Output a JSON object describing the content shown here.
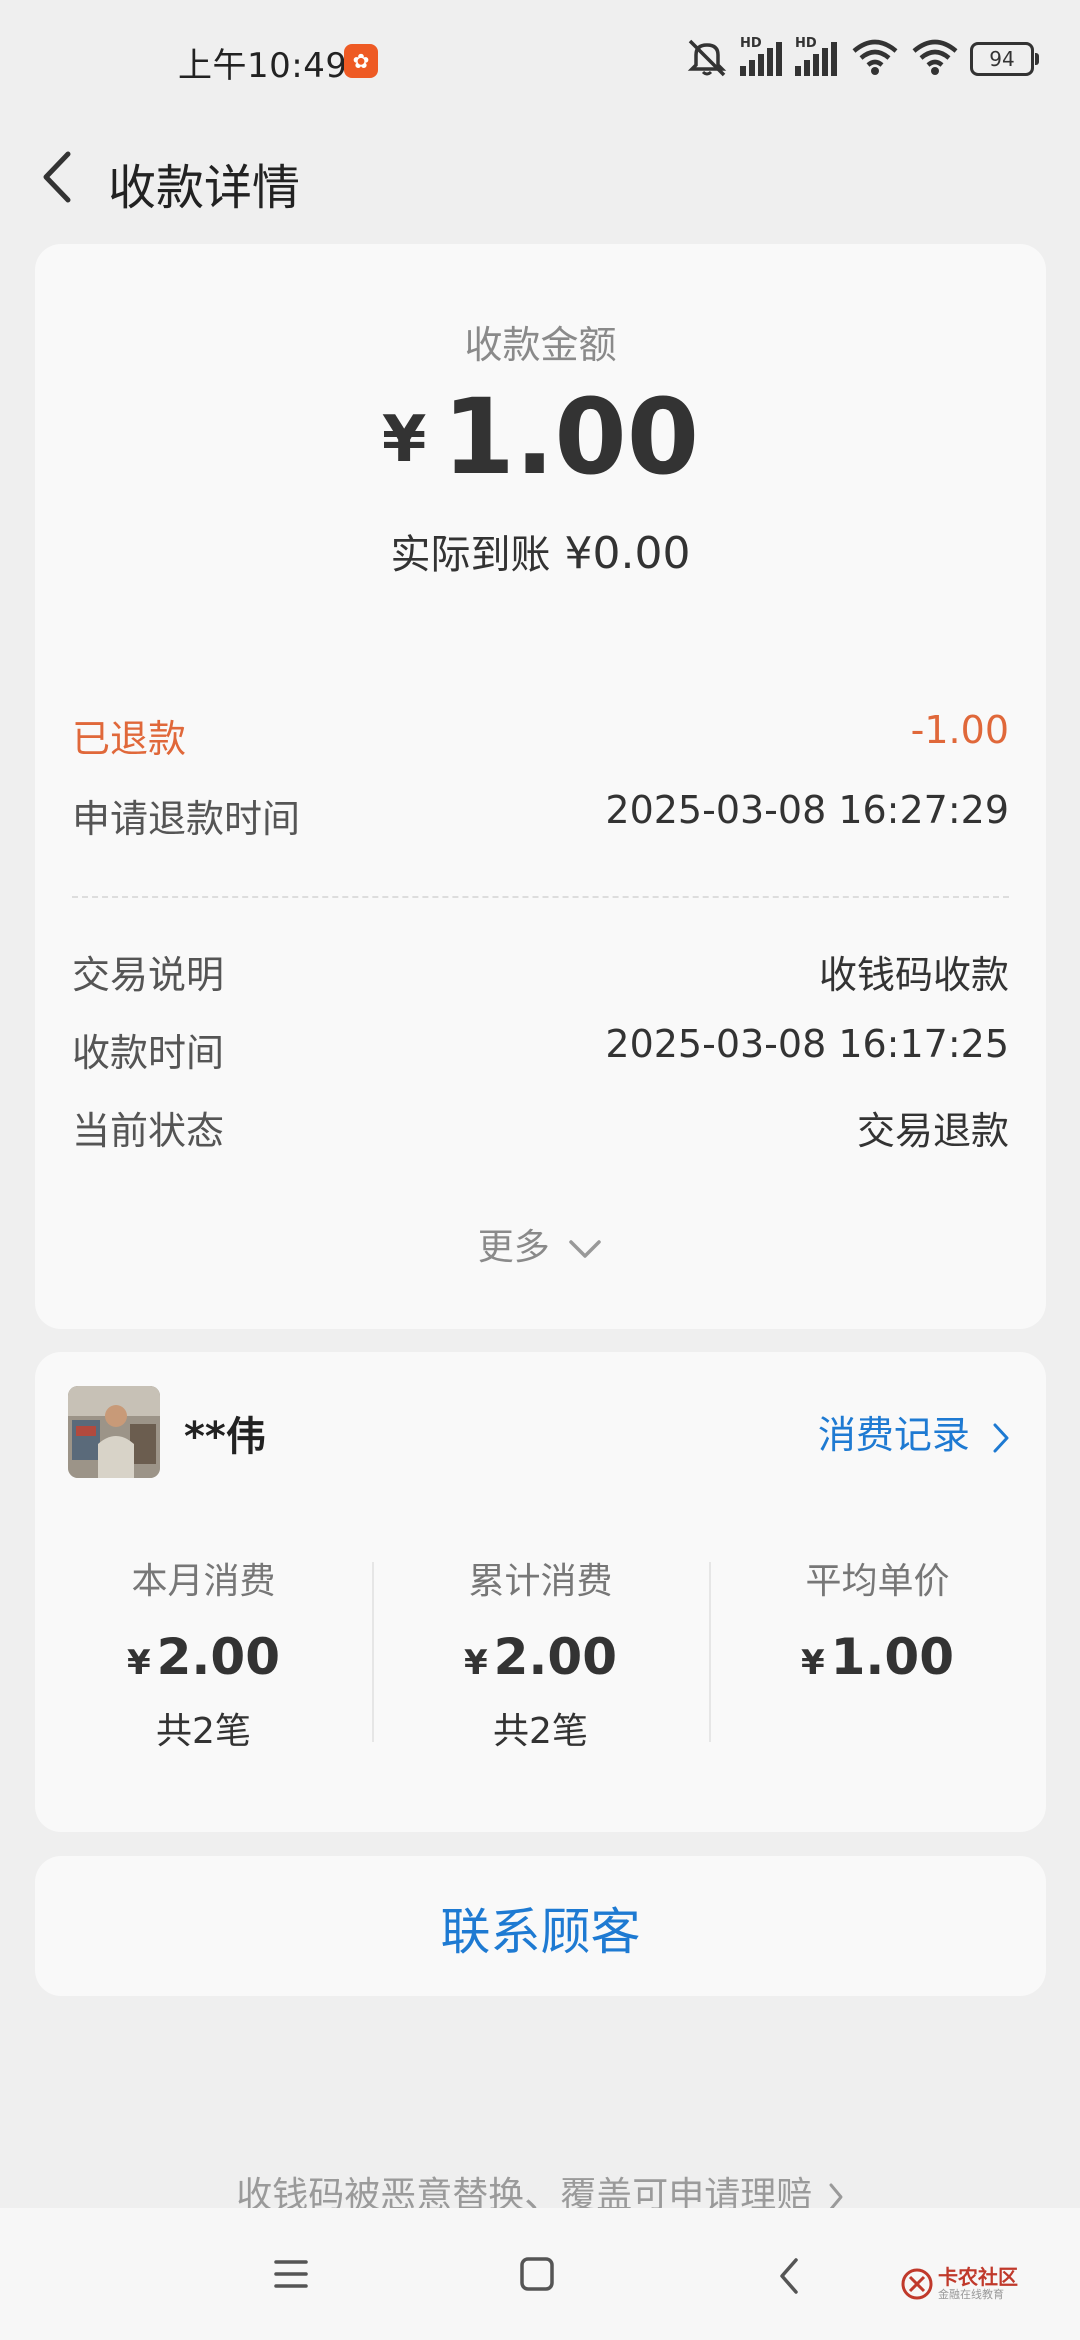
{
  "status_bar": {
    "time": "上午10:49",
    "battery": "94",
    "network_badge": "HD"
  },
  "nav": {
    "title": "收款详情"
  },
  "amount": {
    "label": "收款金额",
    "currency": "¥",
    "value": "1.00",
    "actual_label": "实际到账",
    "actual_value": "¥0.00"
  },
  "refund": {
    "label": "已退款",
    "value": "-1.00"
  },
  "refund_time": {
    "label": "申请退款时间",
    "value": "2025-03-08 16:27:29"
  },
  "details": [
    {
      "label": "交易说明",
      "value": "收钱码收款"
    },
    {
      "label": "收款时间",
      "value": "2025-03-08 16:17:25"
    },
    {
      "label": "当前状态",
      "value": "交易退款"
    }
  ],
  "more_label": "更多",
  "customer": {
    "name": "**伟",
    "records_label": "消费记录",
    "stats": [
      {
        "label": "本月消费",
        "currency": "¥",
        "value": "2.00",
        "count": "共2笔"
      },
      {
        "label": "累计消费",
        "currency": "¥",
        "value": "2.00",
        "count": "共2笔"
      },
      {
        "label": "平均单价",
        "currency": "¥",
        "value": "1.00",
        "count": ""
      }
    ]
  },
  "contact_label": "联系顾客",
  "claim_label": "收钱码被恶意替换、覆盖可申请理赔",
  "watermark": {
    "title": "卡农社区",
    "subtitle": "金融在线教育"
  },
  "colors": {
    "accent_blue": "#1e7ad2",
    "refund_orange": "#e0683a",
    "background": "#efefef",
    "card": "#f9f9f9"
  }
}
